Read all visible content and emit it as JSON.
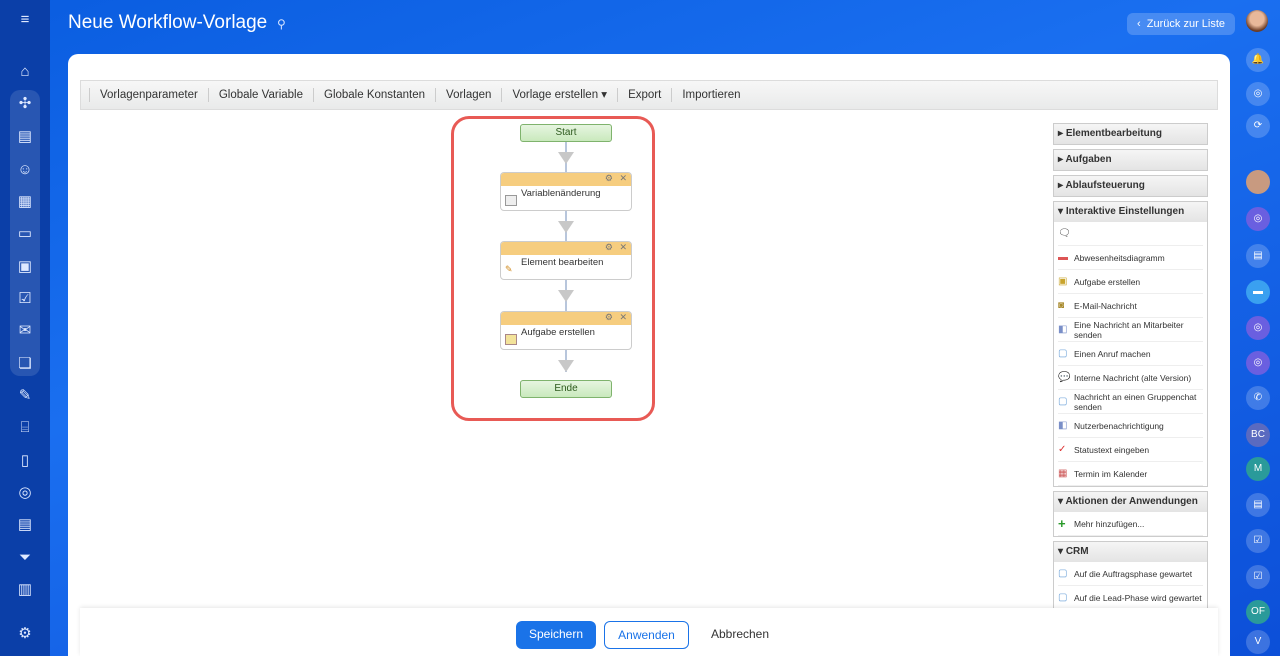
{
  "header": {
    "title": "Neue Workflow-Vorlage",
    "back_label": "Zurück zur Liste"
  },
  "toolbar": [
    "Vorlagenparameter",
    "Globale Variable",
    "Globale Konstanten",
    "Vorlagen",
    "Vorlage erstellen ▾",
    "Export",
    "Importieren"
  ],
  "workflow": {
    "start": "Start",
    "end": "Ende",
    "activities": [
      "Variablenänderung",
      "Element bearbeiten",
      "Aufgabe erstellen"
    ]
  },
  "panel": {
    "collapsed": [
      "Elementbearbeitung",
      "Aufgaben",
      "Ablaufsteuerung"
    ],
    "interactive": {
      "title": "Interaktive Einstellungen",
      "items": [
        "Abwesenheitsdiagramm",
        "Aufgabe erstellen",
        "E-Mail-Nachricht",
        "Eine Nachricht an Mitarbeiter senden",
        "Einen Anruf machen",
        "Interne Nachricht (alte Version)",
        "Nachricht an einen Gruppenchat senden",
        "Nutzerbenachrichtigung",
        "Statustext eingeben",
        "Termin im Kalender"
      ]
    },
    "apps": {
      "title": "Aktionen der Anwendungen",
      "items": [
        "Mehr hinzufügen..."
      ]
    },
    "crm": {
      "title": "CRM",
      "items": [
        "Auf die Auftragsphase gewartet",
        "Auf die Lead-Phase wird gewartet"
      ]
    }
  },
  "footer": {
    "save": "Speichern",
    "apply": "Anwenden",
    "cancel": "Abbrechen"
  },
  "rightbar": {
    "initials": [
      "BC",
      "M",
      "OF",
      "V"
    ]
  }
}
